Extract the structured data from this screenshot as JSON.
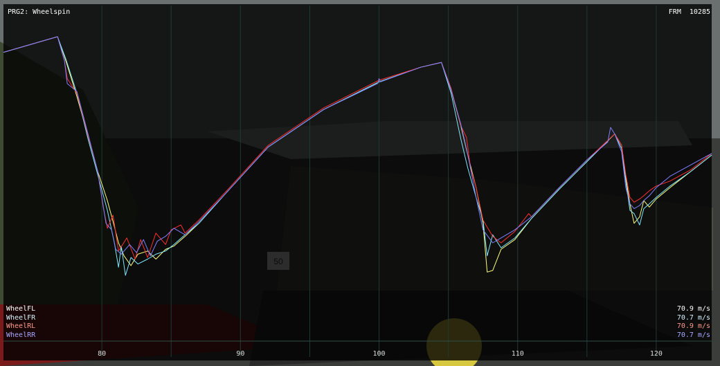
{
  "overlay": {
    "title": "PRG2: Wheelspin",
    "frame_label": "FRM",
    "frame_value": "10285"
  },
  "scene": {
    "sign_text": "50"
  },
  "legend": [
    {
      "name": "WheelFL",
      "value": "70.9 m/s",
      "color": "#ffff80"
    },
    {
      "name": "WheelFR",
      "value": "70.7 m/s",
      "color": "#80e8ff"
    },
    {
      "name": "WheelRL",
      "value": "70.9 m/s",
      "color": "#ff3030"
    },
    {
      "name": "WheelRR",
      "value": "70.7 m/s",
      "color": "#8080ff"
    }
  ],
  "chart_data": {
    "type": "line",
    "title": "PRG2: Wheelspin",
    "xlabel": "",
    "ylabel": "",
    "x_ticks": [
      80,
      90,
      100,
      110,
      120
    ],
    "xlim": [
      72.9,
      124.0
    ],
    "ylim": [
      0,
      100
    ],
    "grid": true,
    "legend_position": "bottom-left",
    "series": [
      {
        "name": "WheelFL",
        "color": "#ffff80",
        "x": [
          72.9,
          76.8,
          77.4,
          78.2,
          79.0,
          79.7,
          80.4,
          80.9,
          81.2,
          81.6,
          82.1,
          82.6,
          83.3,
          83.9,
          84.6,
          85.2,
          86.0,
          87.0,
          89.0,
          92.0,
          96.0,
          100.0,
          103.0,
          104.5,
          105.2,
          105.9,
          106.4,
          107.0,
          107.5,
          107.8,
          108.2,
          108.8,
          109.8,
          111.0,
          113.0,
          115.0,
          117.0,
          117.5,
          117.8,
          118.1,
          118.4,
          118.8,
          119.1,
          119.5,
          120.0,
          121.0,
          122.5,
          124.0
        ],
        "y": [
          88.6,
          93.4,
          86.0,
          75.0,
          63.0,
          52.0,
          43.0,
          35.0,
          30.0,
          26.0,
          23.0,
          26.5,
          27.5,
          25.0,
          28.0,
          29.0,
          32.0,
          36.0,
          45.5,
          59.5,
          71.0,
          79.5,
          84.0,
          85.5,
          77.0,
          66.0,
          57.0,
          47.0,
          36.0,
          21.0,
          21.5,
          28.0,
          31.0,
          37.5,
          46.5,
          55.0,
          63.5,
          60.0,
          50.0,
          42.0,
          36.0,
          38.0,
          43.0,
          41.0,
          43.5,
          47.0,
          52.0,
          57.0
        ]
      },
      {
        "name": "WheelFR",
        "color": "#80e8ff",
        "x": [
          72.9,
          76.8,
          77.4,
          78.2,
          79.0,
          79.7,
          80.4,
          80.9,
          81.2,
          81.4,
          81.7,
          82.1,
          82.6,
          83.3,
          83.9,
          84.6,
          85.2,
          86.0,
          87.0,
          89.0,
          92.0,
          96.0,
          100.0,
          103.0,
          104.5,
          105.2,
          105.9,
          106.4,
          107.0,
          107.5,
          107.8,
          108.2,
          108.8,
          109.8,
          111.0,
          113.0,
          115.0,
          117.0,
          117.5,
          117.8,
          118.1,
          118.4,
          118.8,
          119.1,
          119.5,
          120.0,
          121.0,
          122.5,
          124.0
        ],
        "y": [
          88.6,
          93.4,
          86.5,
          76.0,
          62.0,
          51.0,
          40.0,
          30.0,
          22.5,
          29.0,
          20.0,
          25.5,
          23.5,
          25.0,
          26.5,
          27.5,
          29.5,
          32.5,
          36.0,
          45.5,
          59.5,
          71.0,
          79.5,
          84.0,
          85.5,
          76.0,
          62.0,
          53.0,
          44.0,
          37.0,
          26.0,
          32.5,
          28.5,
          31.5,
          37.5,
          46.5,
          55.0,
          63.5,
          59.0,
          49.0,
          40.0,
          39.0,
          35.5,
          40.5,
          42.0,
          44.0,
          47.5,
          52.0,
          57.0
        ]
      },
      {
        "name": "WheelRL",
        "color": "#ff3030",
        "x": [
          72.9,
          76.8,
          77.3,
          77.5,
          78.2,
          79.0,
          79.7,
          80.1,
          80.4,
          80.8,
          81.2,
          81.8,
          82.4,
          82.8,
          83.3,
          83.9,
          84.6,
          85.0,
          85.7,
          86.0,
          87.0,
          89.0,
          92.0,
          96.0,
          100.0,
          103.0,
          104.5,
          105.2,
          105.9,
          106.3,
          106.6,
          107.0,
          107.5,
          108.2,
          108.8,
          109.8,
          110.8,
          111.0,
          113.0,
          115.0,
          117.0,
          117.5,
          117.8,
          118.1,
          118.4,
          118.8,
          119.1,
          119.5,
          120.0,
          121.0,
          122.5,
          124.0
        ],
        "y": [
          88.6,
          93.4,
          86.0,
          80.5,
          76.0,
          63.0,
          52.0,
          41.0,
          34.5,
          38.5,
          27.5,
          31.5,
          25.0,
          31.0,
          25.5,
          33.0,
          29.5,
          34.0,
          35.5,
          33.0,
          37.0,
          46.0,
          60.0,
          71.5,
          80.0,
          84.0,
          85.5,
          77.5,
          66.0,
          62.5,
          53.0,
          47.0,
          37.0,
          32.0,
          30.0,
          33.5,
          39.0,
          38.0,
          47.0,
          55.5,
          63.5,
          60.0,
          51.0,
          44.0,
          42.5,
          43.5,
          44.5,
          46.0,
          47.5,
          49.0,
          52.5,
          57.5
        ]
      },
      {
        "name": "WheelRR",
        "color": "#8080ff",
        "x": [
          72.9,
          76.8,
          77.3,
          77.5,
          78.2,
          79.0,
          79.7,
          80.0,
          80.3,
          80.7,
          81.0,
          81.4,
          82.0,
          82.5,
          83.0,
          83.5,
          84.0,
          84.6,
          85.2,
          86.0,
          87.0,
          89.0,
          92.0,
          96.0,
          99.9,
          100.0,
          100.1,
          103.0,
          104.5,
          105.2,
          105.9,
          106.3,
          106.5,
          107.0,
          107.5,
          108.2,
          108.8,
          109.8,
          111.0,
          113.0,
          115.0,
          116.5,
          116.7,
          117.0,
          117.5,
          117.8,
          118.1,
          118.4,
          118.8,
          119.1,
          119.5,
          120.0,
          121.0,
          122.5,
          124.0
        ],
        "y": [
          88.6,
          93.4,
          86.0,
          79.0,
          76.5,
          63.5,
          52.0,
          44.0,
          36.0,
          34.0,
          28.0,
          26.5,
          29.5,
          27.0,
          31.0,
          26.0,
          30.5,
          32.0,
          34.5,
          32.5,
          36.5,
          45.5,
          59.5,
          71.0,
          79.0,
          80.5,
          79.5,
          84.0,
          85.5,
          77.0,
          66.5,
          59.0,
          55.0,
          44.0,
          34.0,
          30.0,
          31.5,
          34.0,
          38.0,
          47.0,
          55.5,
          61.0,
          65.5,
          63.5,
          58.0,
          47.0,
          42.0,
          40.5,
          41.5,
          43.0,
          44.5,
          47.0,
          50.5,
          54.0,
          57.5
        ]
      }
    ]
  }
}
